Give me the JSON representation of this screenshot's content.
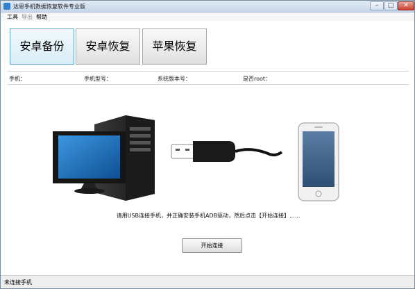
{
  "window": {
    "title": "达思手机数据恢复软件专业版",
    "controls": {
      "minimize": "–",
      "maximize": "□",
      "close": "✕"
    }
  },
  "menu": {
    "tools": "工具",
    "export": "导出",
    "help": "帮助"
  },
  "main_buttons": {
    "android_backup": "安卓备份",
    "android_restore": "安卓恢复",
    "apple_restore": "苹果恢复"
  },
  "device_info": {
    "phone": "手机：",
    "model": "手机型号：",
    "system_version": "系统版本号：",
    "rooted": "是否root："
  },
  "instruction": "请用USB连接手机，并正确安装手机ADB驱动，然后点击【开始连接】......",
  "start_button": "开始连接",
  "status": "未连接手机",
  "colors": {
    "title_bar": "#dfe9f5",
    "active_border": "#5fa5cf",
    "screen_blue": "#1e73be",
    "close_red": "#c9402b"
  },
  "icons": [
    "app-icon",
    "computer-icon",
    "usb-cable-icon",
    "smartphone-icon"
  ]
}
